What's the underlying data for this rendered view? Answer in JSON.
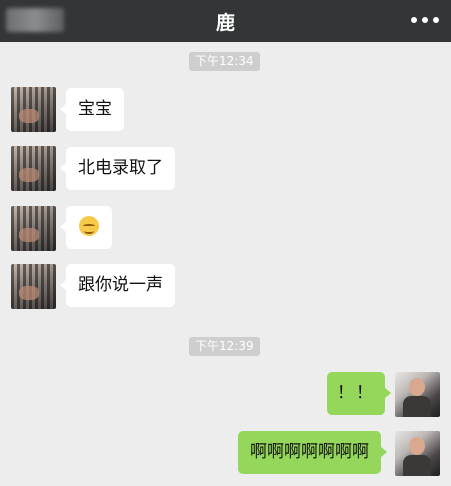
{
  "header": {
    "back_label": "",
    "title": "鹿"
  },
  "messages": [
    {
      "type": "time",
      "text": "下午12:34"
    },
    {
      "type": "in",
      "text": "宝宝"
    },
    {
      "type": "in",
      "text": "北电录取了"
    },
    {
      "type": "in",
      "emoji": "smiling-face-emoji"
    },
    {
      "type": "in",
      "text": "跟你说一声"
    },
    {
      "type": "time",
      "text": "下午12:39"
    },
    {
      "type": "out",
      "text": "！！"
    },
    {
      "type": "out",
      "text": "啊啊啊啊啊啊啊"
    }
  ],
  "colors": {
    "nav_bg": "#333536",
    "chat_bg": "#ededed",
    "out_bubble": "#95d75a",
    "in_bubble": "#ffffff",
    "time_bg": "#cecece"
  },
  "icons": {
    "more": "more-dots-icon"
  }
}
